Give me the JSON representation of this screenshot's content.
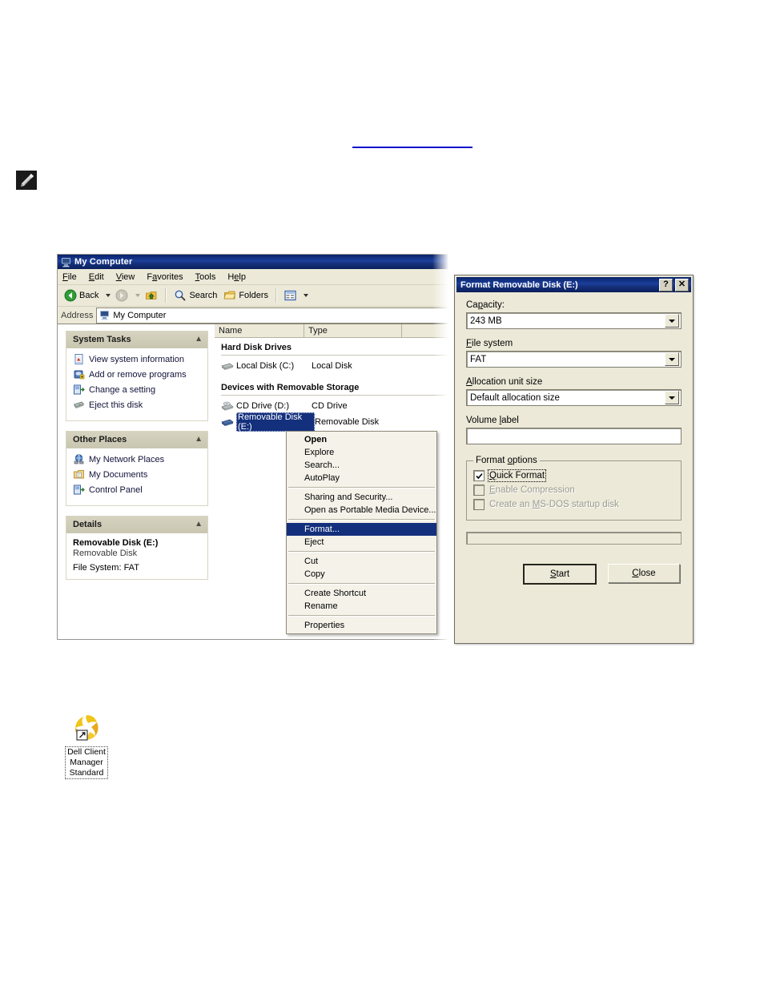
{
  "document": {
    "hyperlink_placeholder": "",
    "note_icon": "note-pencil-icon"
  },
  "explorer": {
    "title": "My Computer",
    "title_icon": "my-computer-icon",
    "menu": [
      {
        "label": "File",
        "accel": "F"
      },
      {
        "label": "Edit",
        "accel": "E"
      },
      {
        "label": "View",
        "accel": "V"
      },
      {
        "label": "Favorites",
        "accel": "a"
      },
      {
        "label": "Tools",
        "accel": "T"
      },
      {
        "label": "Help",
        "accel": "H"
      }
    ],
    "toolbar": {
      "back": "Back",
      "forward": "",
      "up": "",
      "search": "Search",
      "folders": "Folders",
      "views": ""
    },
    "address": {
      "label": "Address",
      "value": "My Computer",
      "icon": "my-computer-icon"
    },
    "task_panels": [
      {
        "title": "System Tasks",
        "items": [
          {
            "label": "View system information",
            "icon": "system-info-icon"
          },
          {
            "label": "Add or remove programs",
            "icon": "add-remove-programs-icon"
          },
          {
            "label": "Change a setting",
            "icon": "change-setting-icon"
          },
          {
            "label": "Eject this disk",
            "icon": "eject-disk-icon"
          }
        ]
      },
      {
        "title": "Other Places",
        "items": [
          {
            "label": "My Network Places",
            "icon": "network-places-icon"
          },
          {
            "label": "My Documents",
            "icon": "my-documents-icon"
          },
          {
            "label": "Control Panel",
            "icon": "control-panel-icon"
          }
        ]
      }
    ],
    "details_panel": {
      "title": "Details",
      "name": "Removable Disk (E:)",
      "type": "Removable Disk",
      "filesystem": "File System: FAT"
    },
    "columns": {
      "name": "Name",
      "type": "Type"
    },
    "groups": [
      {
        "title": "Hard Disk Drives",
        "rows": [
          {
            "name": "Local Disk (C:)",
            "type": "Local Disk",
            "icon": "hard-disk-icon",
            "selected": false
          }
        ]
      },
      {
        "title": "Devices with Removable Storage",
        "rows": [
          {
            "name": "CD Drive (D:)",
            "type": "CD Drive",
            "icon": "cd-drive-icon",
            "selected": false
          },
          {
            "name": "Removable Disk (E:)",
            "type": "Removable Disk",
            "icon": "removable-disk-icon",
            "selected": true
          }
        ]
      }
    ]
  },
  "context_menu": {
    "items": [
      {
        "label": "Open",
        "bold": true,
        "highlighted": false
      },
      {
        "label": "Explore",
        "bold": false,
        "highlighted": false
      },
      {
        "label": "Search...",
        "bold": false,
        "highlighted": false
      },
      {
        "label": "AutoPlay",
        "bold": false,
        "highlighted": false
      },
      {
        "separator": true
      },
      {
        "label": "Sharing and Security...",
        "bold": false,
        "highlighted": false
      },
      {
        "label": "Open as Portable Media Device...",
        "bold": false,
        "highlighted": false
      },
      {
        "separator": true
      },
      {
        "label": "Format...",
        "bold": false,
        "highlighted": true
      },
      {
        "label": "Eject",
        "bold": false,
        "highlighted": false
      },
      {
        "separator": true
      },
      {
        "label": "Cut",
        "bold": false,
        "highlighted": false
      },
      {
        "label": "Copy",
        "bold": false,
        "highlighted": false
      },
      {
        "separator": true
      },
      {
        "label": "Create Shortcut",
        "bold": false,
        "highlighted": false
      },
      {
        "label": "Rename",
        "bold": false,
        "highlighted": false
      },
      {
        "separator": true
      },
      {
        "label": "Properties",
        "bold": false,
        "highlighted": false
      }
    ]
  },
  "format_dialog": {
    "title": "Format Removable Disk (E:)",
    "help_button": "?",
    "close_button": "✕",
    "capacity": {
      "label": "Capacity:",
      "value": "243 MB"
    },
    "file_system": {
      "label": "File system",
      "value": "FAT"
    },
    "allocation_unit": {
      "label": "Allocation unit size",
      "value": "Default allocation size"
    },
    "volume_label": {
      "label": "Volume label",
      "value": ""
    },
    "format_options": {
      "legend": "Format options",
      "checkboxes": [
        {
          "label": "Quick Format",
          "checked": true,
          "disabled": false,
          "focused": true
        },
        {
          "label": "Enable Compression",
          "checked": false,
          "disabled": true,
          "focused": false
        },
        {
          "label": "Create an MS-DOS startup disk",
          "checked": false,
          "disabled": true,
          "focused": false
        }
      ]
    },
    "progress_value": "",
    "buttons": {
      "start": "Start",
      "close": "Close"
    }
  },
  "desktop_shortcut": {
    "label": "Dell Client\nManager\nStandard",
    "icon": "dell-client-manager-icon"
  },
  "colors": {
    "titlebar_blue": "#0a246a",
    "selection_blue": "#14307d",
    "window_face": "#ece9d8",
    "link_blue": "#1111cc",
    "dell_gold": "#e8b417"
  }
}
